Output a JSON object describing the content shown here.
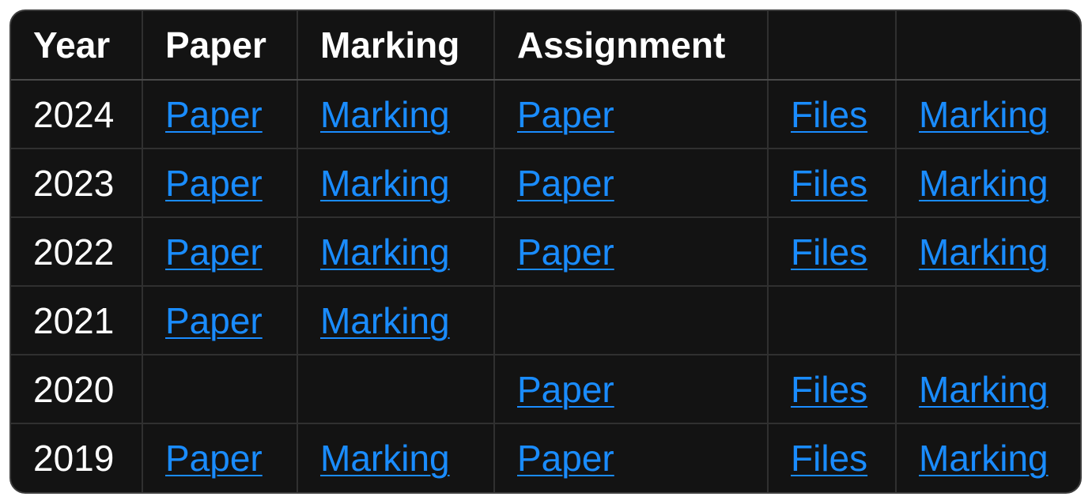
{
  "table": {
    "headers": [
      "Year",
      "Paper",
      "Marking",
      "Assignment",
      "",
      ""
    ],
    "rows": [
      {
        "year": "2024",
        "paper": "Paper",
        "marking": "Marking",
        "assignment_paper": "Paper",
        "assignment_files": "Files",
        "assignment_marking": "Marking"
      },
      {
        "year": "2023",
        "paper": "Paper",
        "marking": "Marking",
        "assignment_paper": "Paper",
        "assignment_files": "Files",
        "assignment_marking": "Marking"
      },
      {
        "year": "2022",
        "paper": "Paper",
        "marking": "Marking",
        "assignment_paper": "Paper",
        "assignment_files": "Files",
        "assignment_marking": "Marking"
      },
      {
        "year": "2021",
        "paper": "Paper",
        "marking": "Marking",
        "assignment_paper": "",
        "assignment_files": "",
        "assignment_marking": ""
      },
      {
        "year": "2020",
        "paper": "",
        "marking": "",
        "assignment_paper": "Paper",
        "assignment_files": "Files",
        "assignment_marking": "Marking"
      },
      {
        "year": "2019",
        "paper": "Paper",
        "marking": "Marking",
        "assignment_paper": "Paper",
        "assignment_files": "Files",
        "assignment_marking": "Marking"
      }
    ]
  },
  "colors": {
    "background": "#131313",
    "border": "#303030",
    "header_text": "#ffffff",
    "link": "#1a8cff"
  }
}
